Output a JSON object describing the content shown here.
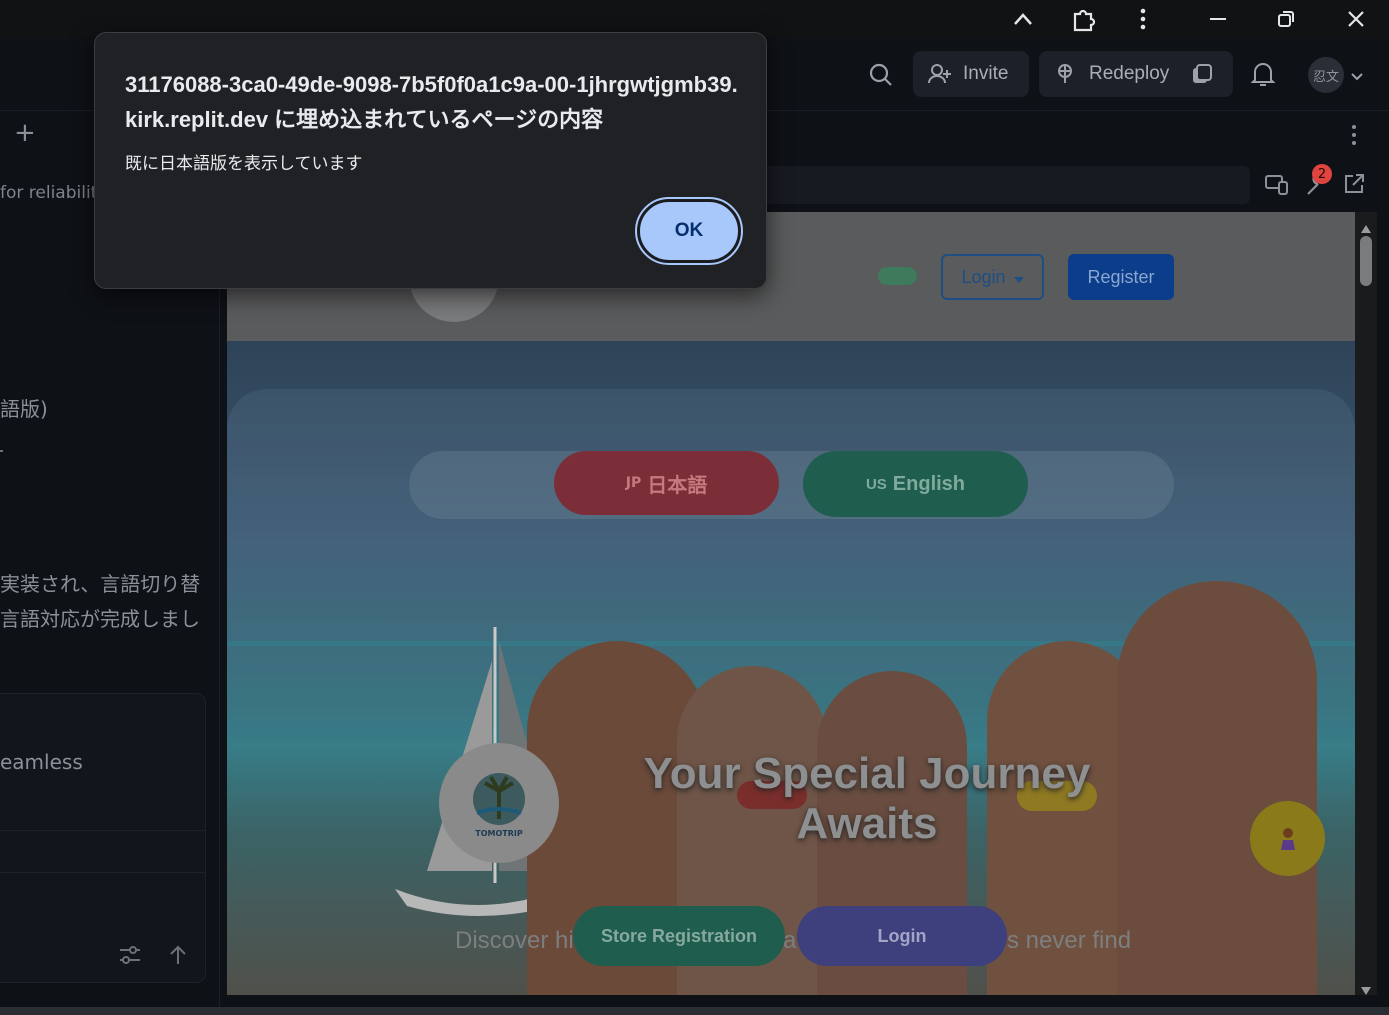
{
  "dialog": {
    "title": "31176088-3ca0-49de-9098-7b5f0f0a1c9a-00-1jhrgwtjgmb39.kirk.replit.dev に埋め込まれているページの内容",
    "message": "既に日本語版を表示しています",
    "ok_label": "OK"
  },
  "header": {
    "invite_label": "Invite",
    "redeploy_label": "Redeploy",
    "avatar_text": "忍文"
  },
  "tabbar": {
    "new_tab": "+"
  },
  "urlbar": {
    "badge_count": "2"
  },
  "left_panel": {
    "snippet_1": "for reliabilit",
    "snippet_2": "語版)",
    "snippet_3": "実装され、言語切り替",
    "snippet_4": "言語対応が完成しまし",
    "snippet_5": "eamless"
  },
  "site": {
    "login_label": "Login",
    "register_label": "Register",
    "lang_jp_flag": "JP",
    "lang_jp_label": "日本語",
    "lang_en_flag": "US",
    "lang_en_label": "English",
    "hero_title_line1": "Your Special Journey",
    "hero_title_line2": "Awaits",
    "hero_subtitle_left": "Discover hic",
    "hero_subtitle_mid": "a",
    "hero_subtitle_right": "s never find",
    "logo_text": "TOMOTRIP",
    "store_registration_label": "Store Registration",
    "hero_login_label": "Login"
  }
}
